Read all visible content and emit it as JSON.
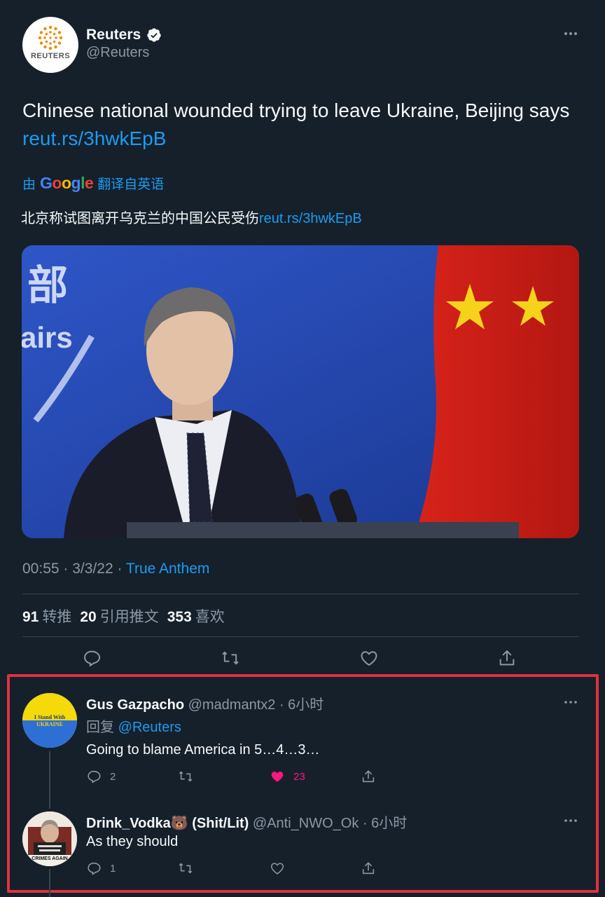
{
  "tweet": {
    "author": {
      "display_name": "Reuters",
      "handle": "@Reuters",
      "avatar_text": "REUTERS",
      "verified_icon": "verified-badge-icon"
    },
    "text": "Chinese national wounded trying to leave Ukraine, Beijing says ",
    "link": "reut.rs/3hwkEpB",
    "translate": {
      "prefix": "由",
      "provider": "Google",
      "suffix": "翻译自英语"
    },
    "translated_text": "北京称试图离开乌克兰的中国公民受伤",
    "translated_link": "reut.rs/3hwkEpB",
    "photo": {
      "sign_text_1": "部",
      "sign_text_2": "airs"
    },
    "time": "00:55",
    "date": "3/3/22",
    "source": "True Anthem",
    "stats": {
      "retweets_count": "91",
      "retweets_label": "转推",
      "quotes_count": "20",
      "quotes_label": "引用推文",
      "likes_count": "353",
      "likes_label": "喜欢"
    },
    "actions": [
      "reply-icon",
      "retweet-icon",
      "like-icon",
      "share-icon"
    ]
  },
  "replies": [
    {
      "display_name": "Gus Gazpacho",
      "handle": "@madmantx2",
      "time": "6小时",
      "reply_to_prefix": "回复",
      "reply_to_handle": "@Reuters",
      "text": "Going to blame America in 5…4…3…",
      "avatar_text_1": "I Stand With",
      "avatar_text_2": "UKRAINE",
      "colors": {
        "top": "#f5d90a",
        "bottom": "#2e6fd6"
      },
      "reply_count": "2",
      "retweet_count": "",
      "like_count": "23",
      "liked": true
    },
    {
      "display_name": "Drink_Vodka🐻 (Shit/Lit)",
      "handle": "@Anti_NWO_Ok",
      "time": "6小时",
      "text": "As they should",
      "avatar_text": "CRIMES AGAIN",
      "reply_count": "1",
      "retweet_count": "",
      "like_count": "",
      "liked": false
    }
  ],
  "colors": {
    "background": "#15202b",
    "link": "#1d9bf0",
    "muted": "#8b98a5",
    "like": "#f91880",
    "highlight_border": "#e0313f"
  }
}
